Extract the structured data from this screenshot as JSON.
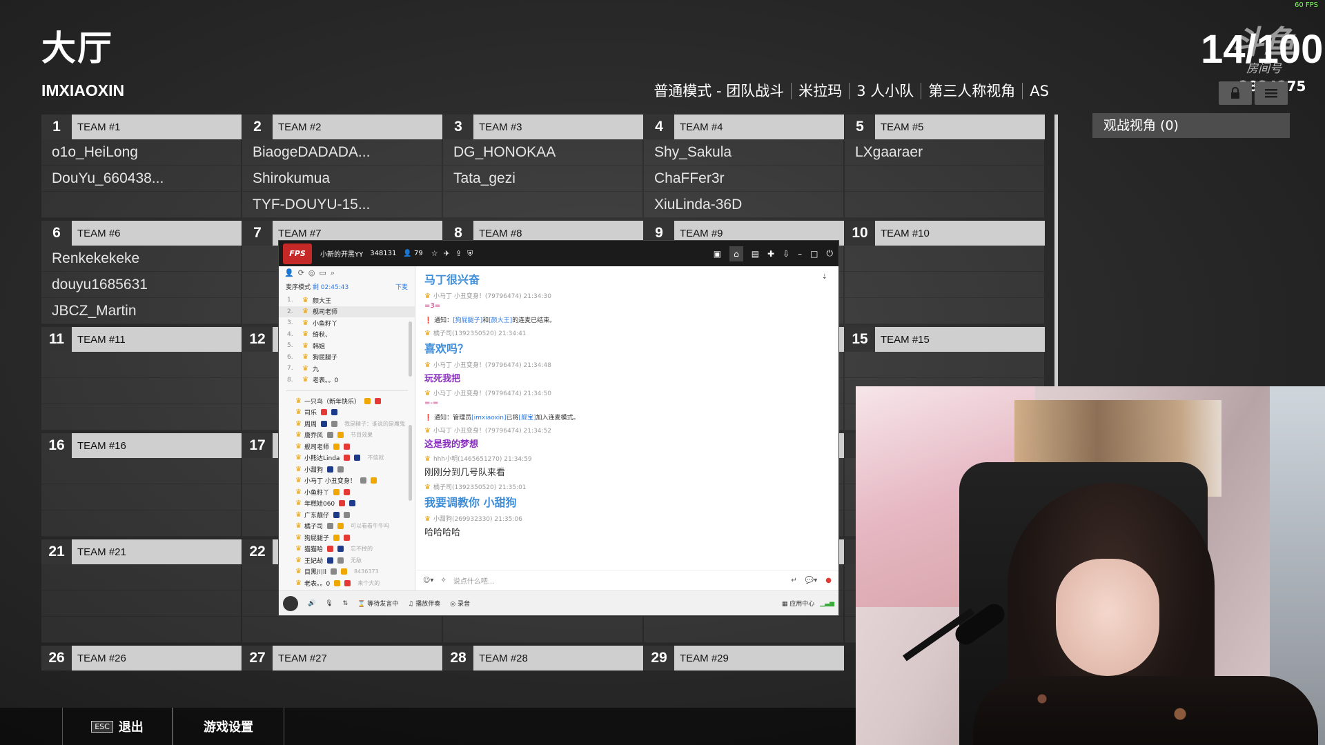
{
  "fps": "60 FPS",
  "title": "大厅",
  "player_name": "IMXIAOXIN",
  "mode": [
    "普通模式 - 团队战斗",
    "米拉玛",
    "3 人小队",
    "第三人称视角",
    "AS"
  ],
  "player_count": "14/100",
  "room": {
    "watermark": "斗鱼",
    "label": "房间号",
    "id": "3834275"
  },
  "spectator_label": "观战视角 (0)",
  "teams": [
    {
      "num": "1",
      "label": "TEAM #1",
      "players": [
        "o1o_HeiLong",
        "DouYu_660438...",
        ""
      ]
    },
    {
      "num": "2",
      "label": "TEAM #2",
      "players": [
        "BiaogeDADADA...",
        "Shirokumua",
        "TYF-DOUYU-15..."
      ]
    },
    {
      "num": "3",
      "label": "TEAM #3",
      "players": [
        "DG_HONOKAA",
        "Tata_gezi",
        ""
      ]
    },
    {
      "num": "4",
      "label": "TEAM #4",
      "players": [
        "Shy_Sakula",
        "ChaFFer3r",
        "XiuLinda-36D"
      ]
    },
    {
      "num": "5",
      "label": "TEAM #5",
      "players": [
        "LXgaaraer",
        "",
        ""
      ]
    },
    {
      "num": "6",
      "label": "TEAM #6",
      "players": [
        "Renkekekeke",
        "douyu1685631",
        "JBCZ_Martin"
      ]
    },
    {
      "num": "7",
      "label": "TEAM #7",
      "players": [
        "",
        "",
        ""
      ]
    },
    {
      "num": "8",
      "label": "TEAM #8",
      "players": [
        "",
        "",
        ""
      ]
    },
    {
      "num": "9",
      "label": "TEAM #9",
      "players": [
        "",
        "",
        ""
      ]
    },
    {
      "num": "10",
      "label": "TEAM #10",
      "players": [
        "",
        "",
        ""
      ]
    },
    {
      "num": "11",
      "label": "TEAM #11",
      "players": [
        "",
        "",
        ""
      ]
    },
    {
      "num": "12",
      "label": "",
      "players": [
        "",
        "",
        ""
      ]
    },
    {
      "num": "",
      "label": "",
      "players": [
        "",
        "",
        ""
      ]
    },
    {
      "num": "",
      "label": "",
      "players": [
        "",
        "",
        ""
      ]
    },
    {
      "num": "15",
      "label": "TEAM #15",
      "players": [
        "",
        "",
        ""
      ]
    },
    {
      "num": "16",
      "label": "TEAM #16",
      "players": [
        "",
        "",
        ""
      ]
    },
    {
      "num": "17",
      "label": "",
      "players": [
        "",
        "",
        ""
      ]
    },
    {
      "num": "",
      "label": "",
      "players": [
        "",
        "",
        ""
      ]
    },
    {
      "num": "",
      "label": "",
      "players": [
        "",
        "",
        ""
      ]
    },
    {
      "num": "",
      "label": "",
      "players": [
        "",
        "",
        ""
      ]
    },
    {
      "num": "21",
      "label": "TEAM #21",
      "players": [
        "",
        "",
        ""
      ]
    },
    {
      "num": "22",
      "label": "",
      "players": [
        "",
        "",
        ""
      ]
    },
    {
      "num": "",
      "label": "",
      "players": [
        "",
        "",
        ""
      ]
    },
    {
      "num": "",
      "label": "",
      "players": [
        "",
        "",
        ""
      ]
    },
    {
      "num": "",
      "label": "",
      "players": [
        "",
        "",
        ""
      ]
    },
    {
      "num": "26",
      "label": "TEAM #26",
      "players": []
    },
    {
      "num": "27",
      "label": "TEAM #27",
      "players": []
    },
    {
      "num": "28",
      "label": "TEAM #28",
      "players": []
    },
    {
      "num": "29",
      "label": "TEAM #29",
      "players": []
    }
  ],
  "footer": {
    "esc_key": "ESC",
    "exit": "退出",
    "settings": "游戏设置"
  },
  "yy": {
    "logo": "FPS",
    "channel": "小新的开黑YY",
    "channel_id": "348131",
    "users": "79",
    "mic_mode": "麦序模式",
    "timer": "剩 02:45:43",
    "down": "下麦",
    "mic_list": [
      {
        "n": "1.",
        "name": "颜大王"
      },
      {
        "n": "2.",
        "name": "舰司老师"
      },
      {
        "n": "3.",
        "name": "小鱼籽丫"
      },
      {
        "n": "4.",
        "name": "绮秋、"
      },
      {
        "n": "5.",
        "name": "韩姐"
      },
      {
        "n": "6.",
        "name": "狗屁腿子"
      },
      {
        "n": "7.",
        "name": "九"
      },
      {
        "n": "8.",
        "name": "老表。。0"
      }
    ],
    "user_list": [
      {
        "name": "一只鸟（新年快乐）",
        "tag": ""
      },
      {
        "name": "司乐",
        "tag": ""
      },
      {
        "name": "周周",
        "tag": "我是精子：谁说的是魔鬼"
      },
      {
        "name": "唐乔风",
        "tag": "节目效果"
      },
      {
        "name": "舰司老师",
        "tag": ""
      },
      {
        "name": "小熊达Linda",
        "tag": "不信就"
      },
      {
        "name": "小甜狗",
        "tag": ""
      },
      {
        "name": "小马丁 小丑变身！",
        "tag": ""
      },
      {
        "name": "小鱼籽丫",
        "tag": ""
      },
      {
        "name": "年糕娃060",
        "tag": ""
      },
      {
        "name": "广东靓仔",
        "tag": ""
      },
      {
        "name": "橘子司",
        "tag": "可以看看牛牛吗"
      },
      {
        "name": "狗屁腿子",
        "tag": ""
      },
      {
        "name": "猫猫哈",
        "tag": "忘不掉的"
      },
      {
        "name": "王妃劫",
        "tag": "无敌"
      },
      {
        "name": "目黑川ll",
        "tag": "8436373"
      },
      {
        "name": "老表。。0",
        "tag": "来个大的"
      }
    ],
    "chat": [
      {
        "type": "big",
        "text": "马丁很兴奋"
      },
      {
        "type": "meta",
        "text": "小马丁 小丑变身！(79796474)  21:34:30"
      },
      {
        "type": "small",
        "text": "=3="
      },
      {
        "type": "notice",
        "pre": "通知：",
        "a": "[狗屁腿子]",
        "mid": "和",
        "b": "[颜大王]",
        "post": "的连麦已结束。"
      },
      {
        "type": "meta",
        "text": "橘子司(1392350520)  21:34:41"
      },
      {
        "type": "big",
        "text": "喜欢吗？"
      },
      {
        "type": "meta",
        "text": "小马丁 小丑变身！(79796474)  21:34:48"
      },
      {
        "type": "purple",
        "text": "玩死我把"
      },
      {
        "type": "meta",
        "text": "小马丁 小丑变身！(79796474)  21:34:50"
      },
      {
        "type": "small",
        "text": "=-="
      },
      {
        "type": "notice",
        "pre": "通知：管理员",
        "a": "[imxiaoxin]",
        "mid": "已将",
        "b": "[舰宝]",
        "post": "加入连麦模式。"
      },
      {
        "type": "meta",
        "text": "小马丁 小丑变身！(79796474)  21:34:52"
      },
      {
        "type": "purple",
        "text": "这是我的梦想"
      },
      {
        "type": "meta",
        "text": "hhh小明(1465651270)  21:34:59"
      },
      {
        "type": "dark",
        "text": "刚刚分到几号队来看"
      },
      {
        "type": "meta",
        "text": "橘子司(1392350520)  21:35:01"
      },
      {
        "type": "big",
        "text": "我要调教你 小甜狗"
      },
      {
        "type": "meta",
        "text": "小甜狗(269932330)  21:35:06"
      },
      {
        "type": "dark",
        "text": "哈哈哈哈"
      }
    ],
    "input_placeholder": "说点什么吧...",
    "bottom": {
      "waiting": "等待发言中",
      "music": "播放伴奏",
      "record": "录音",
      "apps": "应用中心"
    }
  }
}
